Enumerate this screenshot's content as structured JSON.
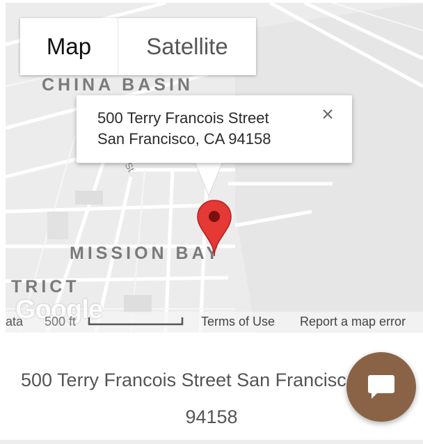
{
  "map": {
    "type_controls": {
      "map_label": "Map",
      "satellite_label": "Satellite",
      "selected": "Map"
    },
    "area_labels": {
      "china_basin": "CHINA BASIN",
      "mission_bay": "MISSION BAY",
      "district_fragment": "TRICT"
    },
    "street_fragment": "St",
    "info_window": {
      "line1": "500 Terry Francois Street",
      "line2": "San Francisco, CA 94158"
    },
    "marker_color": "#e53935",
    "attribution": {
      "logo": "Google",
      "data_fragment": "ata",
      "scale_label": "500 ft",
      "terms": "Terms of Use",
      "report": "Report a map error"
    }
  },
  "address": {
    "line1": "500 Terry Francois Street San Francisco, CA",
    "line2": "94158"
  },
  "chat_button": {
    "icon": "chat-bubble-icon",
    "color": "#8a6346"
  }
}
